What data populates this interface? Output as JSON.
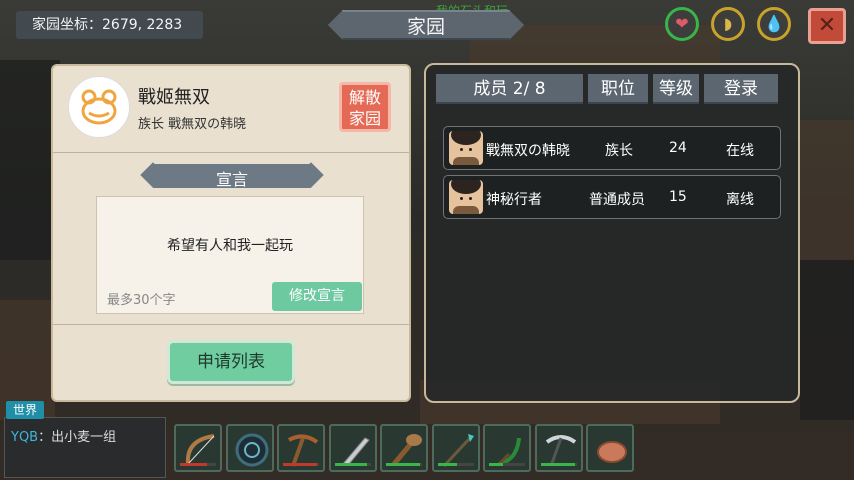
{
  "hud": {
    "coordinates": "家园坐标：2679, 2283",
    "window_title": "家园",
    "background_text": "我的石头和玩",
    "close_icon": "close-icon",
    "status_icons": [
      "heart-icon",
      "hunger-icon",
      "water-drop-icon"
    ]
  },
  "clan": {
    "name": "戰姬無双",
    "leader_line": "族长  戰無双の韩晓",
    "disband_label": "解散家园",
    "declaration_heading": "宣言",
    "declaration_text": "希望有人和我一起玩",
    "declaration_hint": "最多30个字",
    "edit_label": "修改宣言",
    "apply_list_label": "申请列表"
  },
  "members": {
    "headers": [
      "成员 2/ 8",
      "职位",
      "等级",
      "登录"
    ],
    "rows": [
      {
        "name": "戰無双の韩晓",
        "role": "族长",
        "level": "24",
        "status": "在线"
      },
      {
        "name": "神秘行者",
        "role": "普通成员",
        "level": "15",
        "status": "离线"
      }
    ]
  },
  "chat": {
    "channel": "世界",
    "user": "YQB",
    "message": "：出小麦一组"
  },
  "hotbar": [
    {
      "icon": "bow-icon",
      "durability": 0.75,
      "color": "#c0392b"
    },
    {
      "icon": "shield-orb-icon",
      "durability": 0,
      "color": "#c0392b"
    },
    {
      "icon": "pickaxe-icon",
      "durability": 0.95,
      "color": "#c0392b"
    },
    {
      "icon": "knife-icon",
      "durability": 0.9,
      "color": "#39b54a"
    },
    {
      "icon": "club-icon",
      "durability": 0.95,
      "color": "#39b54a"
    },
    {
      "icon": "spear-icon",
      "durability": 0.55,
      "color": "#39b54a"
    },
    {
      "icon": "sickle-icon",
      "durability": 0.4,
      "color": "#39b54a"
    },
    {
      "icon": "iron-pickaxe-icon",
      "durability": 0.95,
      "color": "#39b54a"
    },
    {
      "icon": "meat-icon",
      "durability": 0,
      "color": "#39b54a"
    }
  ]
}
